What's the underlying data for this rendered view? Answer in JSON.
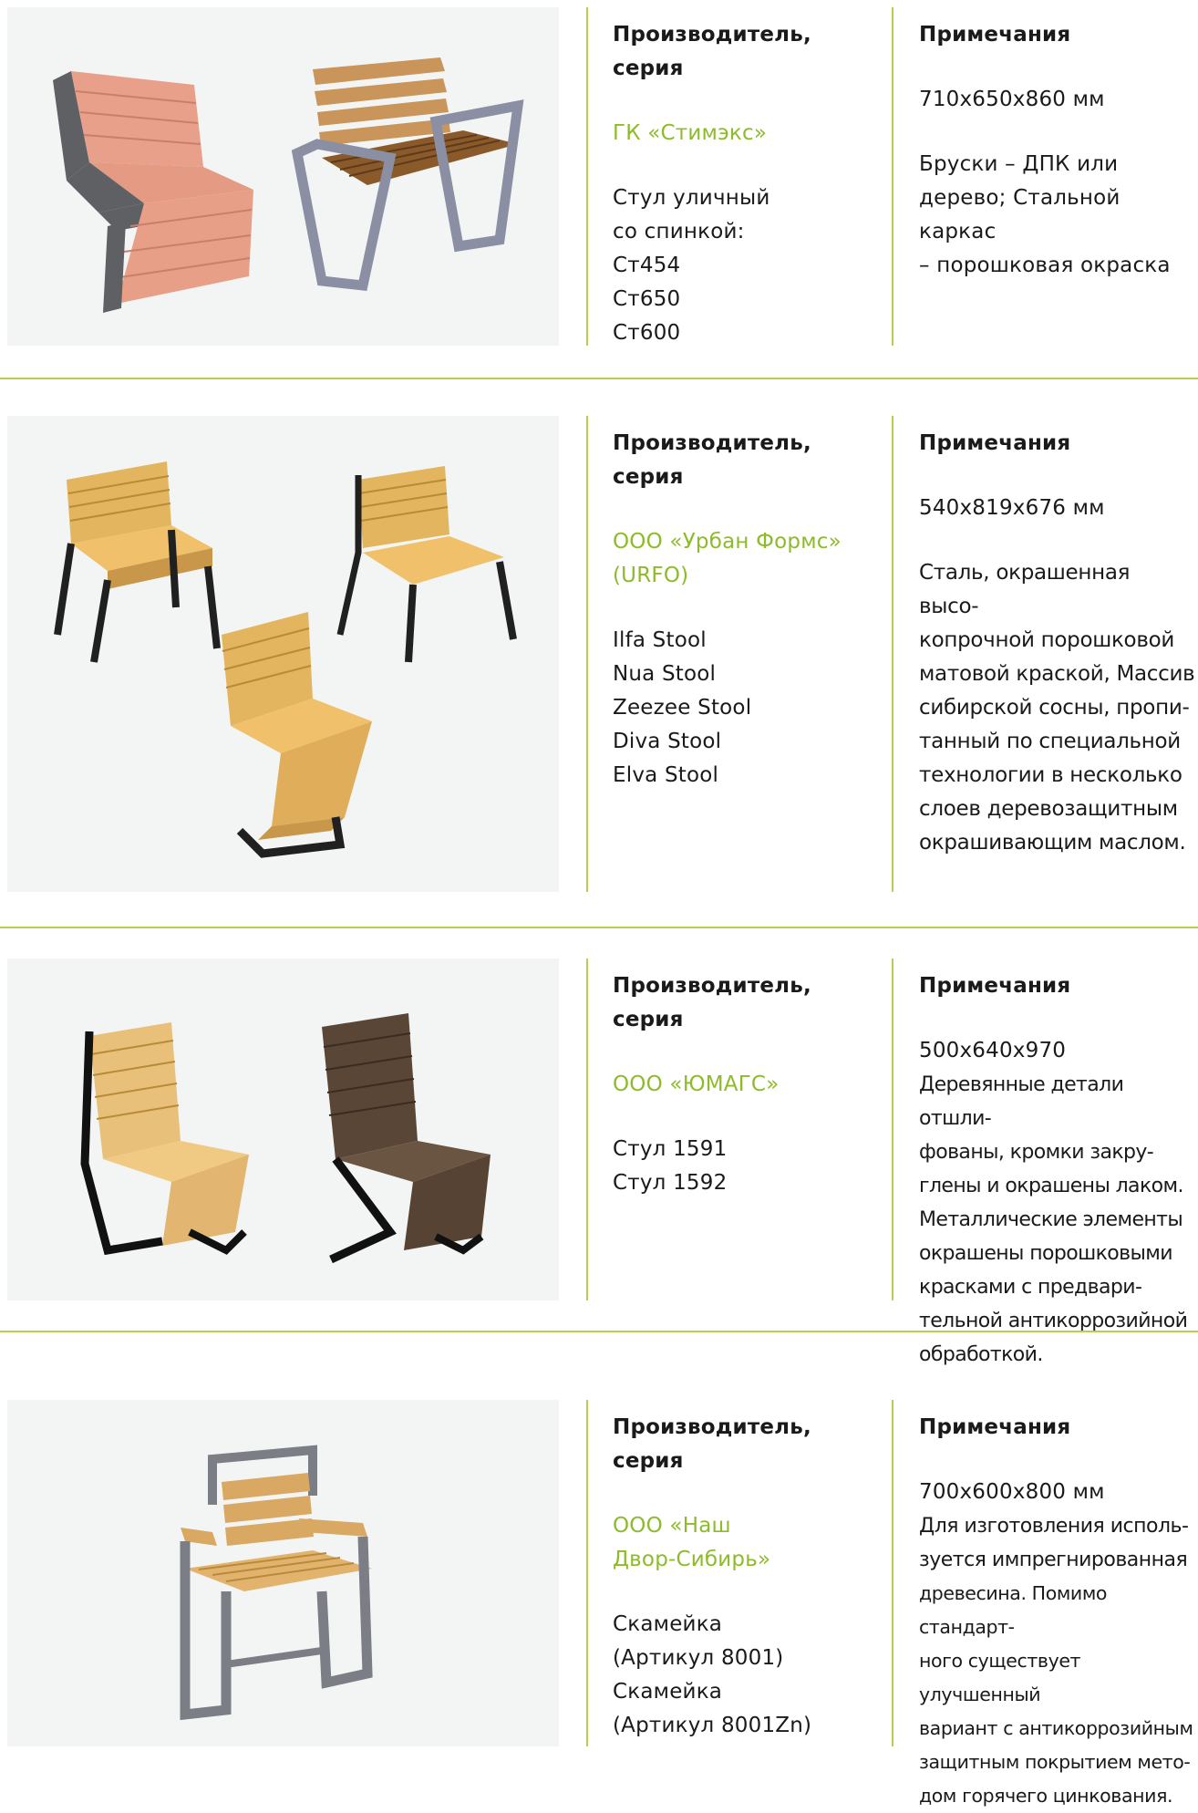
{
  "sections": [
    {
      "header_maker": "Производитель, серия",
      "header_notes": "Примечания",
      "maker": [
        "ГК «Стимэкс»"
      ],
      "items": [
        "Стул уличный",
        "со спинкой:",
        "Ст454",
        "Ст650",
        "Ст600"
      ],
      "dims": "710х650х860 мм",
      "notes": [
        "Бруски – ДПК или",
        "дерево; Стальной каркас",
        "– порошковая окраска"
      ]
    },
    {
      "header_maker": "Производитель, серия",
      "header_notes": "Примечания",
      "maker": [
        "ООО «Урбан Формс»",
        "(URFO)"
      ],
      "items": [
        "Ilfa Stool",
        "Nua Stool",
        "Zeezee Stool",
        "Diva Stool",
        "Elva Stool"
      ],
      "dims": "540х819х676 мм",
      "notes": [
        "Сталь, окрашенная высо-",
        "копрочной порошковой",
        "матовой краской, Массив",
        "сибирской сосны, пропи-",
        "танный по специальной",
        "технологии в несколько",
        "слоев деревозащитным",
        "окрашивающим маслом."
      ]
    },
    {
      "header_maker": "Производитель, серия",
      "header_notes": "Примечания",
      "maker": [
        "ООО «ЮМАГС»"
      ],
      "items": [
        "Стул 1591",
        "Стул 1592"
      ],
      "dims": "500х640х970",
      "notes": [
        "Деревянные детали отшли-",
        "фованы, кромки закру-",
        "глены и окрашены лаком.",
        "Металлические элементы",
        "окрашены порошковыми",
        "красками с предвари-",
        "тельной антикоррозийной",
        "обработкой."
      ]
    },
    {
      "header_maker": "Производитель, серия",
      "header_notes": "Примечания",
      "maker": [
        "ООО «Наш",
        "Двор-Сибирь»"
      ],
      "items": [
        "Скамейка",
        "(Артикул 8001)",
        "Скамейка",
        "(Артикул 8001Zn)"
      ],
      "dims": "700х600х800 мм",
      "notes": [
        "Для изготовления исполь-",
        "зуется импрегнированная",
        "древесина. Помимо стандарт-",
        "ного существует улучшенный",
        "вариант с антикоррозийным",
        "защитным покрытием мето-",
        "дом горячего цинкования."
      ]
    }
  ],
  "colors": {
    "accent": "#8dbb2a",
    "rule": "#b9cf4a",
    "image_bg": "#f3f4f4"
  }
}
